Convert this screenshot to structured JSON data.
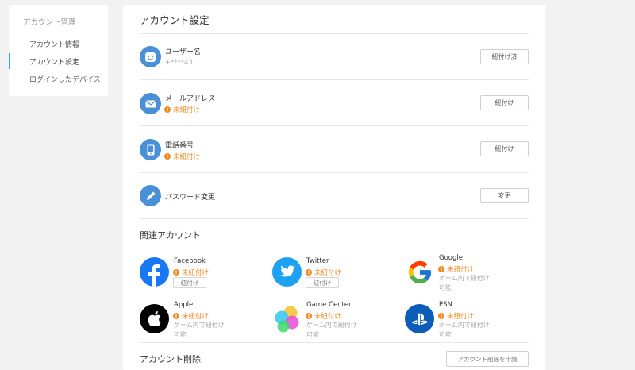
{
  "sidebar": {
    "heading": "アカウント管理",
    "items": [
      {
        "label": "アカウント情報"
      },
      {
        "label": "アカウント設定"
      },
      {
        "label": "ログインしたデバイス"
      }
    ]
  },
  "main": {
    "title": "アカウント設定",
    "rows": [
      {
        "label": "ユーザー名",
        "sub": "+****43",
        "button": "紐付け済"
      },
      {
        "label": "メールアドレス",
        "status": "未紐付け",
        "button": "紐付け"
      },
      {
        "label": "電話番号",
        "status": "未紐付け",
        "button": "紐付け"
      },
      {
        "label": "パスワード変更",
        "button": "変更"
      }
    ],
    "linked_title": "関連アカウント",
    "services": [
      {
        "name": "Facebook",
        "status": "未紐付け",
        "button": "紐付け"
      },
      {
        "name": "Twitter",
        "status": "未紐付け",
        "button": "紐付け"
      },
      {
        "name": "Google",
        "status": "未紐付け",
        "note1": "ゲーム内で紐付け",
        "note2": "可能"
      },
      {
        "name": "Apple",
        "status": "未紐付け",
        "note1": "ゲーム内で紐付け",
        "note2": "可能"
      },
      {
        "name": "Game Center",
        "status": "未紐付け",
        "note1": "ゲーム内で紐付け",
        "note2": "可能"
      },
      {
        "name": "PSN",
        "status": "未紐付け",
        "note1": "ゲーム内で紐付け",
        "note2": "可能"
      }
    ],
    "delete_title": "アカウント削除",
    "delete_button": "アカウント削除を申請"
  },
  "colors": {
    "accent": "#3aa0dc",
    "icon_blue": "#4a90d6",
    "warning": "#f08a24",
    "facebook": "#1877f2",
    "twitter": "#1da1f2",
    "psn": "#0b5db7"
  },
  "icons": {
    "username": "smiley-face-icon",
    "email": "envelope-icon",
    "phone": "phone-icon",
    "password": "pencil-icon"
  }
}
